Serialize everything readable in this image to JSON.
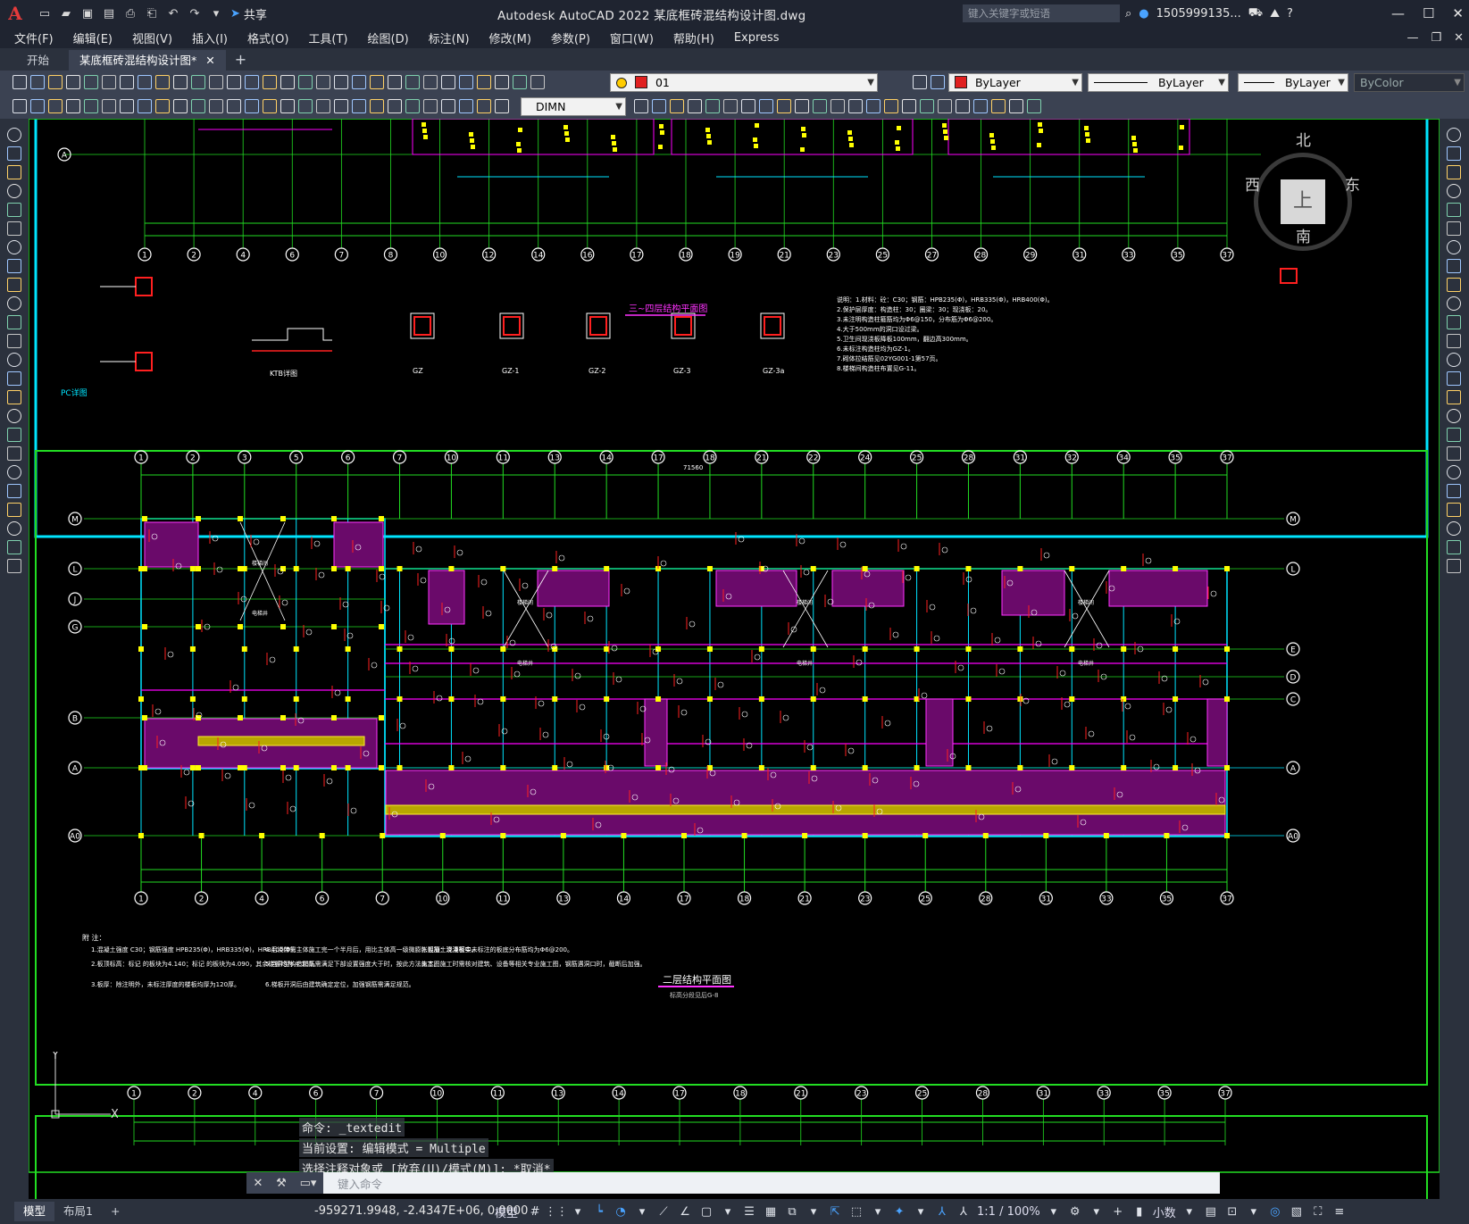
{
  "app": {
    "logo": "A",
    "title": "Autodesk AutoCAD 2022    某底框砖混结构设计图.dwg",
    "share_label": "共享",
    "search_placeholder": "键入关键字或短语",
    "user": "1505999135...",
    "colors": {
      "accent": "#4aa3ff",
      "titlebar": "#1f2430",
      "canvas": "#000000",
      "frame_cyan": "#00e5ff",
      "frame_green": "#22dd22"
    }
  },
  "menu": [
    "文件(F)",
    "编辑(E)",
    "视图(V)",
    "插入(I)",
    "格式(O)",
    "工具(T)",
    "绘图(D)",
    "标注(N)",
    "修改(M)",
    "参数(P)",
    "窗口(W)",
    "帮助(H)",
    "Express"
  ],
  "tabs": {
    "start": "开始",
    "active": "某底框砖混结构设计图*",
    "add": "+"
  },
  "toolbar": {
    "layer_value": "01",
    "color_value": "ByLayer",
    "linetype_value": "ByLayer",
    "lineweight_value": "ByLayer",
    "plotstyle_value": "ByColor",
    "dimstyle_value": "DIMN"
  },
  "viewcube": {
    "north": "北",
    "south": "南",
    "east": "东",
    "west": "西",
    "face": "上"
  },
  "drawing": {
    "upper_plan_title": "三~四层结构平面图",
    "main_plan_title": "二层结构平面图",
    "main_plan_subtitle": "标高分段见后G-8",
    "overall_dim": "71560",
    "pc_detail": "PC详图",
    "ktb_detail": "KTB详图",
    "column_labels": [
      "GZ",
      "GZ-1",
      "GZ-2",
      "GZ-3",
      "GZ-3a"
    ],
    "axis_top": [
      "1",
      "2",
      "3",
      "5",
      "6",
      "7",
      "10",
      "11",
      "13",
      "14",
      "17",
      "18",
      "21",
      "22",
      "24",
      "25",
      "28",
      "31",
      "32",
      "34",
      "35",
      "37"
    ],
    "axis_bottom": [
      "1",
      "2",
      "4",
      "6",
      "7",
      "10",
      "11",
      "13",
      "14",
      "17",
      "18",
      "21",
      "23",
      "25",
      "28",
      "31",
      "33",
      "35",
      "37"
    ],
    "axis_upper_plan": [
      "1",
      "2",
      "4",
      "6",
      "7",
      "8",
      "10",
      "12",
      "14",
      "16",
      "17",
      "18",
      "19",
      "21",
      "23",
      "25",
      "27",
      "28",
      "29",
      "31",
      "33",
      "35",
      "37"
    ],
    "axis_rows": [
      "M",
      "L",
      "J",
      "G",
      "B",
      "A",
      "A0"
    ],
    "axis_rows_right": [
      "M",
      "L",
      "E",
      "D",
      "C",
      "A",
      "A0"
    ],
    "notes_heading": "附 注：",
    "notes": [
      "1.混凝土强度 C30；钢筋强度 HPB235(Φ)，HRB335(Φ)，HRB400(Φ)。",
      "2.板顶标高：标记 的板块为4.140；标记 的板块为4.090，其余楼板均为 4.150。",
      "3.板厚：除注明外，未标注厚度的楼板均厚为120厚。",
      "4.后浇带需主体施工完一个半月后，用比主体高一级微膨胀混凝土浇灌密实。",
      "5.当异型构造配筋需满足下部设置强度大于时，按此方法施工。",
      "6.梯板开洞后由建筑确定定位，加强钢筋需满足规范。",
      "7.板筋：现浇板中未标注的板底分布筋均为Φ6@200。",
      "8.本图施工时需核对建筑、设备等相关专业施工图，钢筋遇洞口时，截断后加强。"
    ],
    "upper_notes": [
      "说明：1.材料：砼：C30；钢筋：HPB235(Φ)，HRB335(Φ)，HRB400(Φ)。",
      "2.保护层厚度：构造柱：30；圈梁：30；现浇板：20。",
      "3.未注明构造柱箍筋均为Φ6@150，分布筋为Φ6@200。",
      "4.大于500mm的洞口设过梁。",
      "5.卫生间现浇板降板100mm，翻边高300mm。",
      "6.未标注构造柱均为GZ-1。",
      "7.砌体拉结筋见02YG001-1第57页。",
      "8.楼梯间构造柱布置见G-11。"
    ],
    "stair_labels": [
      "楼梯间",
      "电梯井"
    ]
  },
  "command": {
    "history": [
      "命令: _textedit",
      "当前设置: 编辑模式 = Multiple",
      "选择注释对象或 [放弃(U)/模式(M)]: *取消*"
    ],
    "input_placeholder": "键入命令"
  },
  "status": {
    "layout_tabs": [
      "模型",
      "布局1"
    ],
    "add_tab": "+",
    "coords": "-959271.9948, -2.4347E+06, 0.0000",
    "mode": "模型",
    "scale": "1:1 / 100%",
    "units": "小数"
  }
}
